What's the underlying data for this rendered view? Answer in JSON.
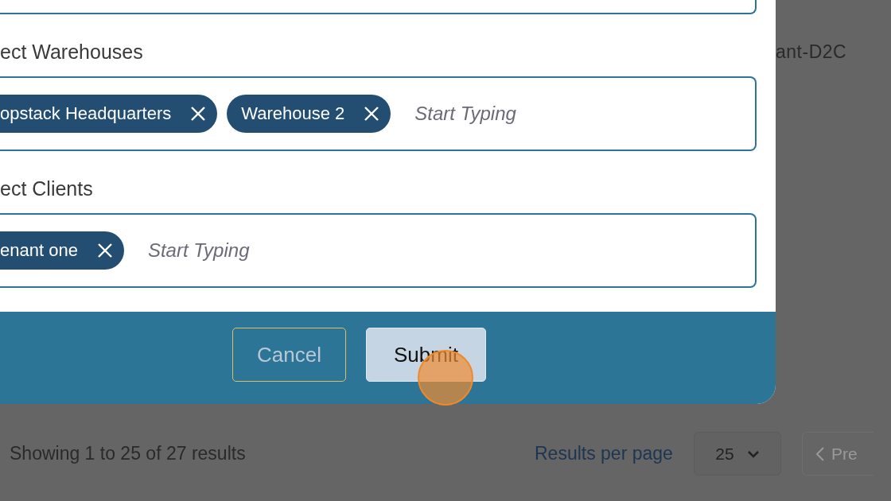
{
  "background": {
    "tenant_cell": "ant-D2C",
    "pagination": {
      "summary": "Showing 1 to 25 of 27 results",
      "per_page_label": "Results per page",
      "per_page_value": "25",
      "prev_button": "Pre"
    }
  },
  "modal": {
    "fields": [
      {
        "label": "ect Warehouses",
        "chips": [
          "opstack Headquarters",
          "Warehouse 2"
        ],
        "placeholder": "Start Typing"
      },
      {
        "label": "ect Clients",
        "chips": [
          "enant one"
        ],
        "placeholder": "Start Typing"
      }
    ],
    "buttons": [
      {
        "kind": "cancel",
        "label": "Cancel"
      },
      {
        "kind": "submit",
        "label": "Submit"
      }
    ]
  }
}
